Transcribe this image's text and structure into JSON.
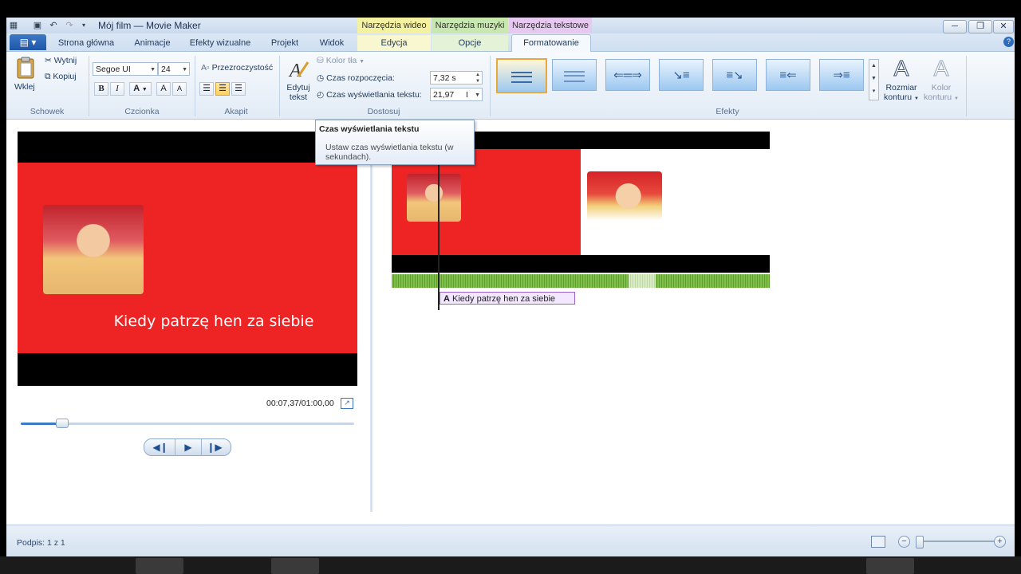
{
  "window": {
    "title": "Mój film — Movie Maker",
    "qat_icons": [
      "app-icon",
      "save-icon",
      "undo-icon",
      "redo-icon",
      "customize-qat-icon"
    ],
    "controls": {
      "minimize": "─",
      "maximize": "❐",
      "close": "✕"
    }
  },
  "context_tabs": {
    "video": {
      "group": "Narzędzia wideo",
      "tab": "Edycja",
      "color": "#f4f1a0"
    },
    "music": {
      "group": "Narzędzia muzyki",
      "tab": "Opcje",
      "color": "#c8e8b0"
    },
    "text": {
      "group": "Narzędzia tekstowe",
      "tab": "Formatowanie",
      "color": "#e6c8f0"
    }
  },
  "tabs": [
    {
      "label": "Strona główna"
    },
    {
      "label": "Animacje"
    },
    {
      "label": "Efekty wizualne"
    },
    {
      "label": "Projekt"
    },
    {
      "label": "Widok"
    }
  ],
  "ribbon": {
    "schowek": {
      "label": "Schowek",
      "paste": "Wklej",
      "cut": "Wytnij",
      "copy": "Kopiuj"
    },
    "czcionka": {
      "label": "Czcionka",
      "font": "Segoe UI",
      "size": "24",
      "bold": "B",
      "italic": "I",
      "color": "A",
      "grow": "A",
      "shrink": "A"
    },
    "akapit": {
      "label": "Akapit",
      "transparency": "Przezroczystość"
    },
    "dostosuj": {
      "label": "Dostosuj",
      "edit_text_line1": "Edytuj",
      "edit_text_line2": "tekst",
      "bg_color": "Kolor tła",
      "start_time_label": "Czas rozpoczęcia:",
      "start_time_value": "7,32 s",
      "duration_label": "Czas wyświetlania tekstu:",
      "duration_value": "21,97"
    },
    "efekty": {
      "label": "Efekty",
      "outline_size_line1": "Rozmiar",
      "outline_size_line2": "konturu",
      "outline_color_line1": "Kolor",
      "outline_color_line2": "konturu"
    }
  },
  "tooltip": {
    "title": "Czas wyświetlania tekstu",
    "body": "Ustaw czas wyświetlania tekstu (w sekundach)."
  },
  "preview": {
    "caption": "Kiedy patrzę hen za siebie",
    "time": "00:07,37/01:00,00",
    "progress": 0.123,
    "buttons": {
      "prev": "◀❙",
      "play": "▶",
      "next": "❙▶"
    }
  },
  "timeline": {
    "text_clip": "Kiedy patrzę hen za siebie",
    "text_clip_icon": "A"
  },
  "status": {
    "caption": "Podpis: 1 z 1",
    "zoom_out": "−",
    "zoom_in": "+"
  }
}
